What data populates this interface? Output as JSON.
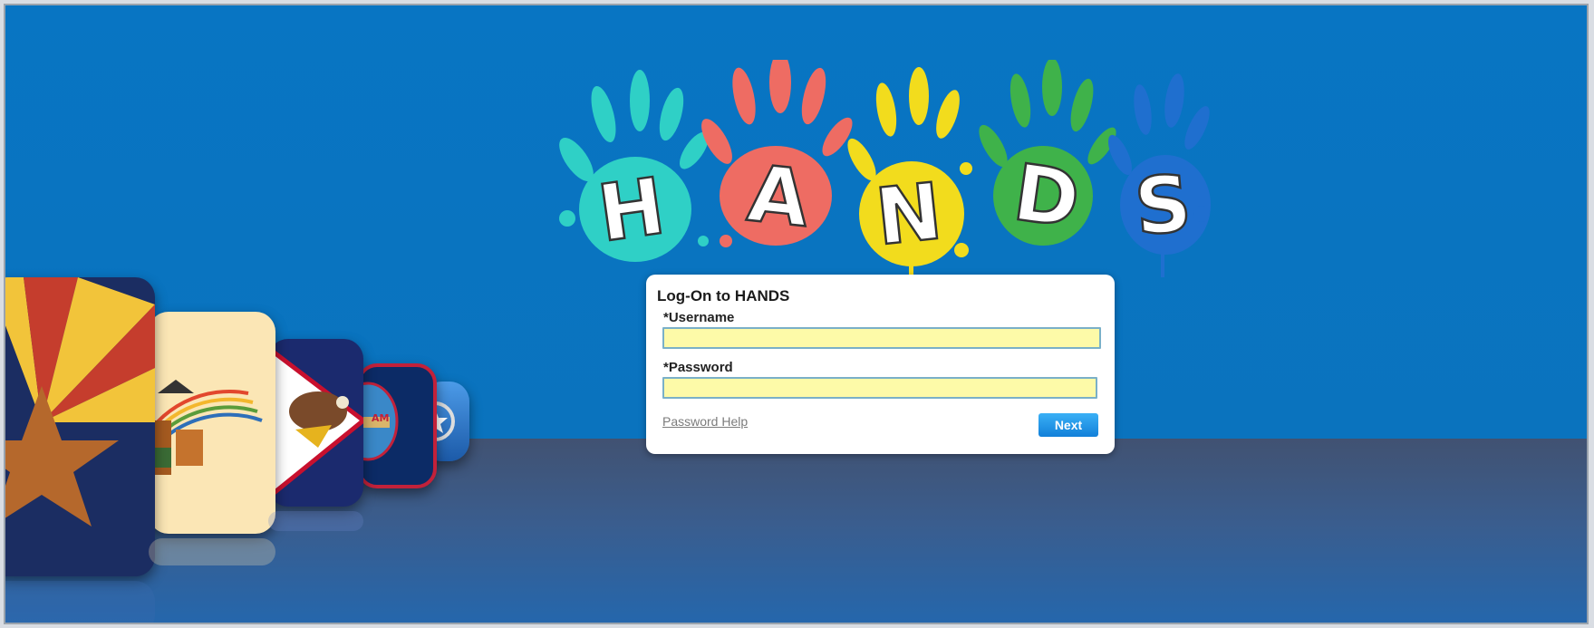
{
  "logo": {
    "letters": [
      "H",
      "A",
      "N",
      "D",
      "S"
    ],
    "colors": [
      "#2fd0c6",
      "#ee6c63",
      "#f2dc1d",
      "#3fb24a",
      "#1f6fcf"
    ]
  },
  "login": {
    "title": "Log-On to HANDS",
    "username_label": "*Username",
    "username_value": "",
    "password_label": "*Password",
    "password_value": "",
    "help_link": "Password Help",
    "next_label": "Next"
  },
  "colors": {
    "background_top": "#0875c3",
    "floor": "#3a5d8e",
    "input_bg": "#fdfaa8",
    "button": "#1a8be3"
  },
  "icons": [
    "arizona-flag-icon",
    "navajo-seal-icon",
    "american-samoa-flag-icon",
    "guam-flag-icon",
    "northern-mariana-flag-icon"
  ]
}
